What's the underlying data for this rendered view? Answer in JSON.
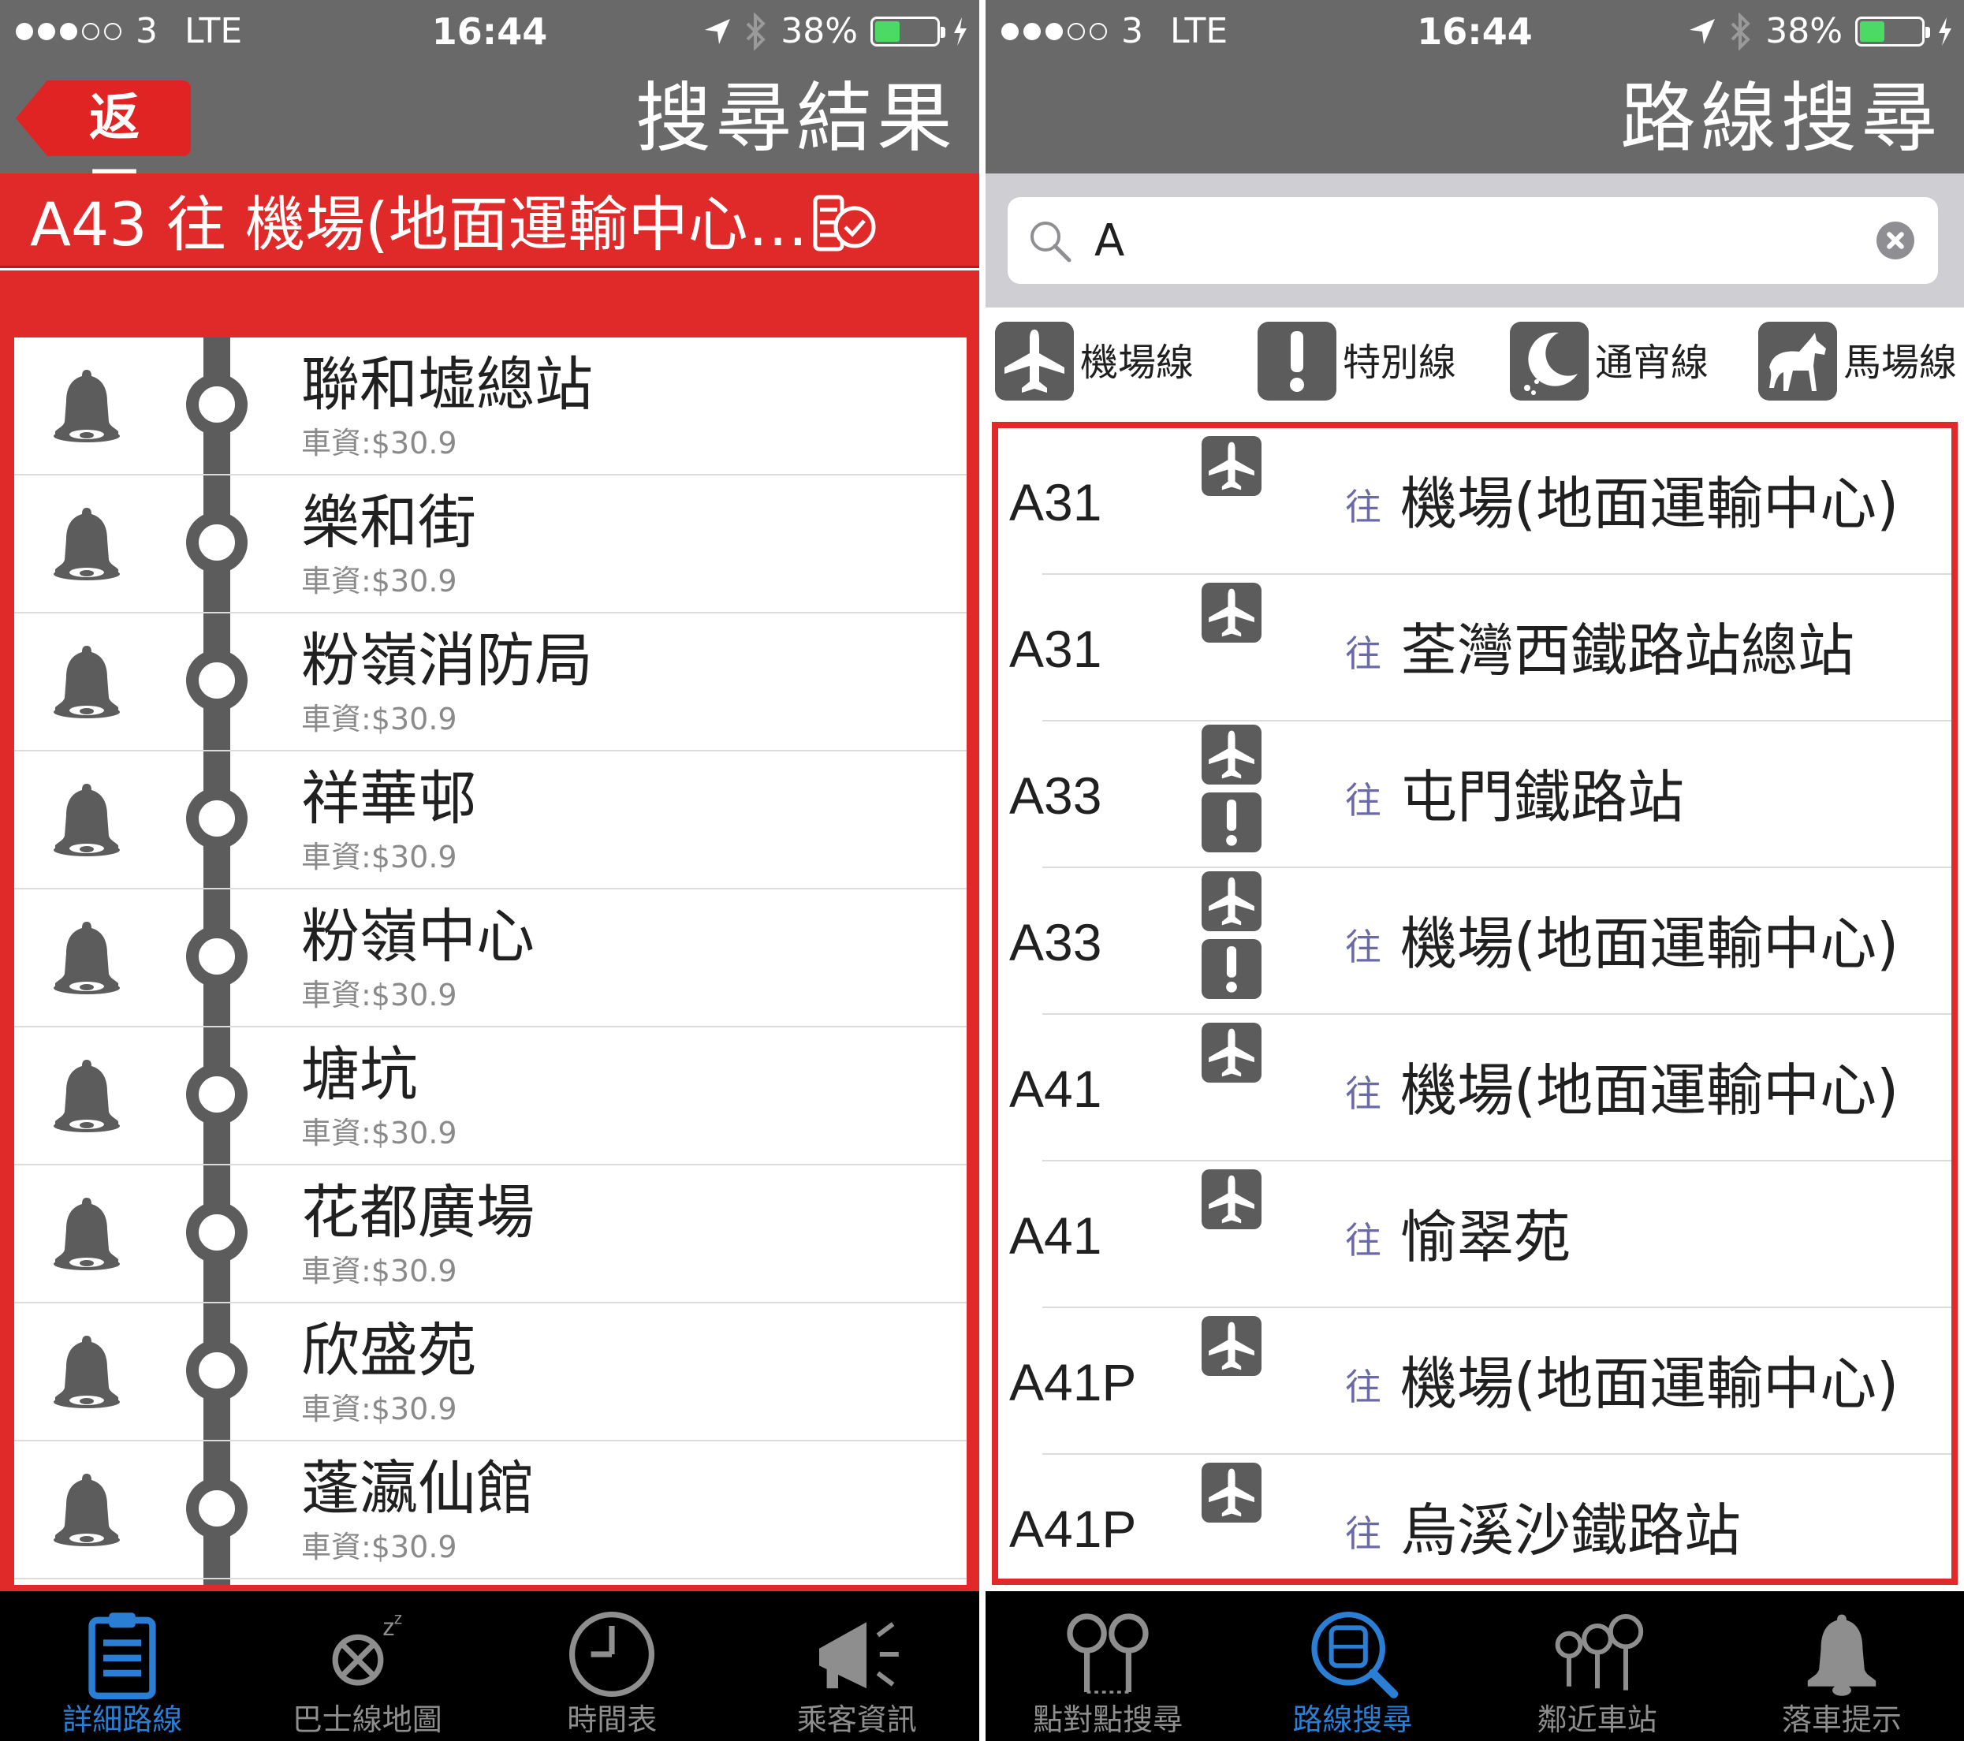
{
  "status_bar": {
    "carrier": "3",
    "network": "LTE",
    "time": "16:44",
    "battery": "38%",
    "battery_level": 0.38
  },
  "left_screen": {
    "nav_title": "搜尋結果",
    "back_label": "返回",
    "route_header": "A43 往 機場(地面運輸中心…",
    "stops": [
      {
        "name": "聯和墟總站",
        "fare": "車資:$30.9"
      },
      {
        "name": "樂和街",
        "fare": "車資:$30.9"
      },
      {
        "name": "粉嶺消防局",
        "fare": "車資:$30.9"
      },
      {
        "name": "祥華邨",
        "fare": "車資:$30.9"
      },
      {
        "name": "粉嶺中心",
        "fare": "車資:$30.9"
      },
      {
        "name": "塘坑",
        "fare": "車資:$30.9"
      },
      {
        "name": "花都廣場",
        "fare": "車資:$30.9"
      },
      {
        "name": "欣盛苑",
        "fare": "車資:$30.9"
      },
      {
        "name": "蓬瀛仙館",
        "fare": "車資:$30.9"
      }
    ],
    "tabs": [
      {
        "label": "詳細路線",
        "icon": "clipboard-list-icon",
        "active": true
      },
      {
        "label": "巴士線地圖",
        "icon": "map-pin-icon",
        "active": false
      },
      {
        "label": "時間表",
        "icon": "clock-icon",
        "active": false
      },
      {
        "label": "乘客資訊",
        "icon": "megaphone-icon",
        "active": false
      }
    ]
  },
  "right_screen": {
    "nav_title": "路線搜尋",
    "search": {
      "value": "A",
      "placeholder": ""
    },
    "filters": [
      {
        "label": "機場線",
        "icon": "airplane-icon"
      },
      {
        "label": "特別線",
        "icon": "exclamation-icon"
      },
      {
        "label": "通宵線",
        "icon": "moon-icon"
      },
      {
        "label": "馬場線",
        "icon": "horse-icon"
      }
    ],
    "to_label": "往",
    "results": [
      {
        "route": "A31",
        "dest": "機場(地面運輸中心)",
        "badges": [
          "airplane"
        ]
      },
      {
        "route": "A31",
        "dest": "荃灣西鐵路站總站",
        "badges": [
          "airplane"
        ]
      },
      {
        "route": "A33",
        "dest": "屯門鐵路站",
        "badges": [
          "airplane",
          "exclamation"
        ]
      },
      {
        "route": "A33",
        "dest": "機場(地面運輸中心)",
        "badges": [
          "airplane",
          "exclamation"
        ]
      },
      {
        "route": "A41",
        "dest": "機場(地面運輸中心)",
        "badges": [
          "airplane"
        ]
      },
      {
        "route": "A41",
        "dest": "愉翠苑",
        "badges": [
          "airplane"
        ]
      },
      {
        "route": "A41P",
        "dest": "機場(地面運輸中心)",
        "badges": [
          "airplane"
        ]
      },
      {
        "route": "A41P",
        "dest": "烏溪沙鐵路站",
        "badges": [
          "airplane"
        ]
      }
    ],
    "tabs": [
      {
        "label": "點對點搜尋",
        "icon": "pins-icon",
        "active": false
      },
      {
        "label": "路線搜尋",
        "icon": "bus-search-icon",
        "active": true
      },
      {
        "label": "鄰近車站",
        "icon": "nearby-pins-icon",
        "active": false
      },
      {
        "label": "落車提示",
        "icon": "bell-icon",
        "active": false
      }
    ]
  },
  "colors": {
    "nav_gray": "#696969",
    "accent_red": "#e02a2a",
    "active_blue": "#2a7fd4",
    "icon_gray": "#5c5c5c"
  }
}
